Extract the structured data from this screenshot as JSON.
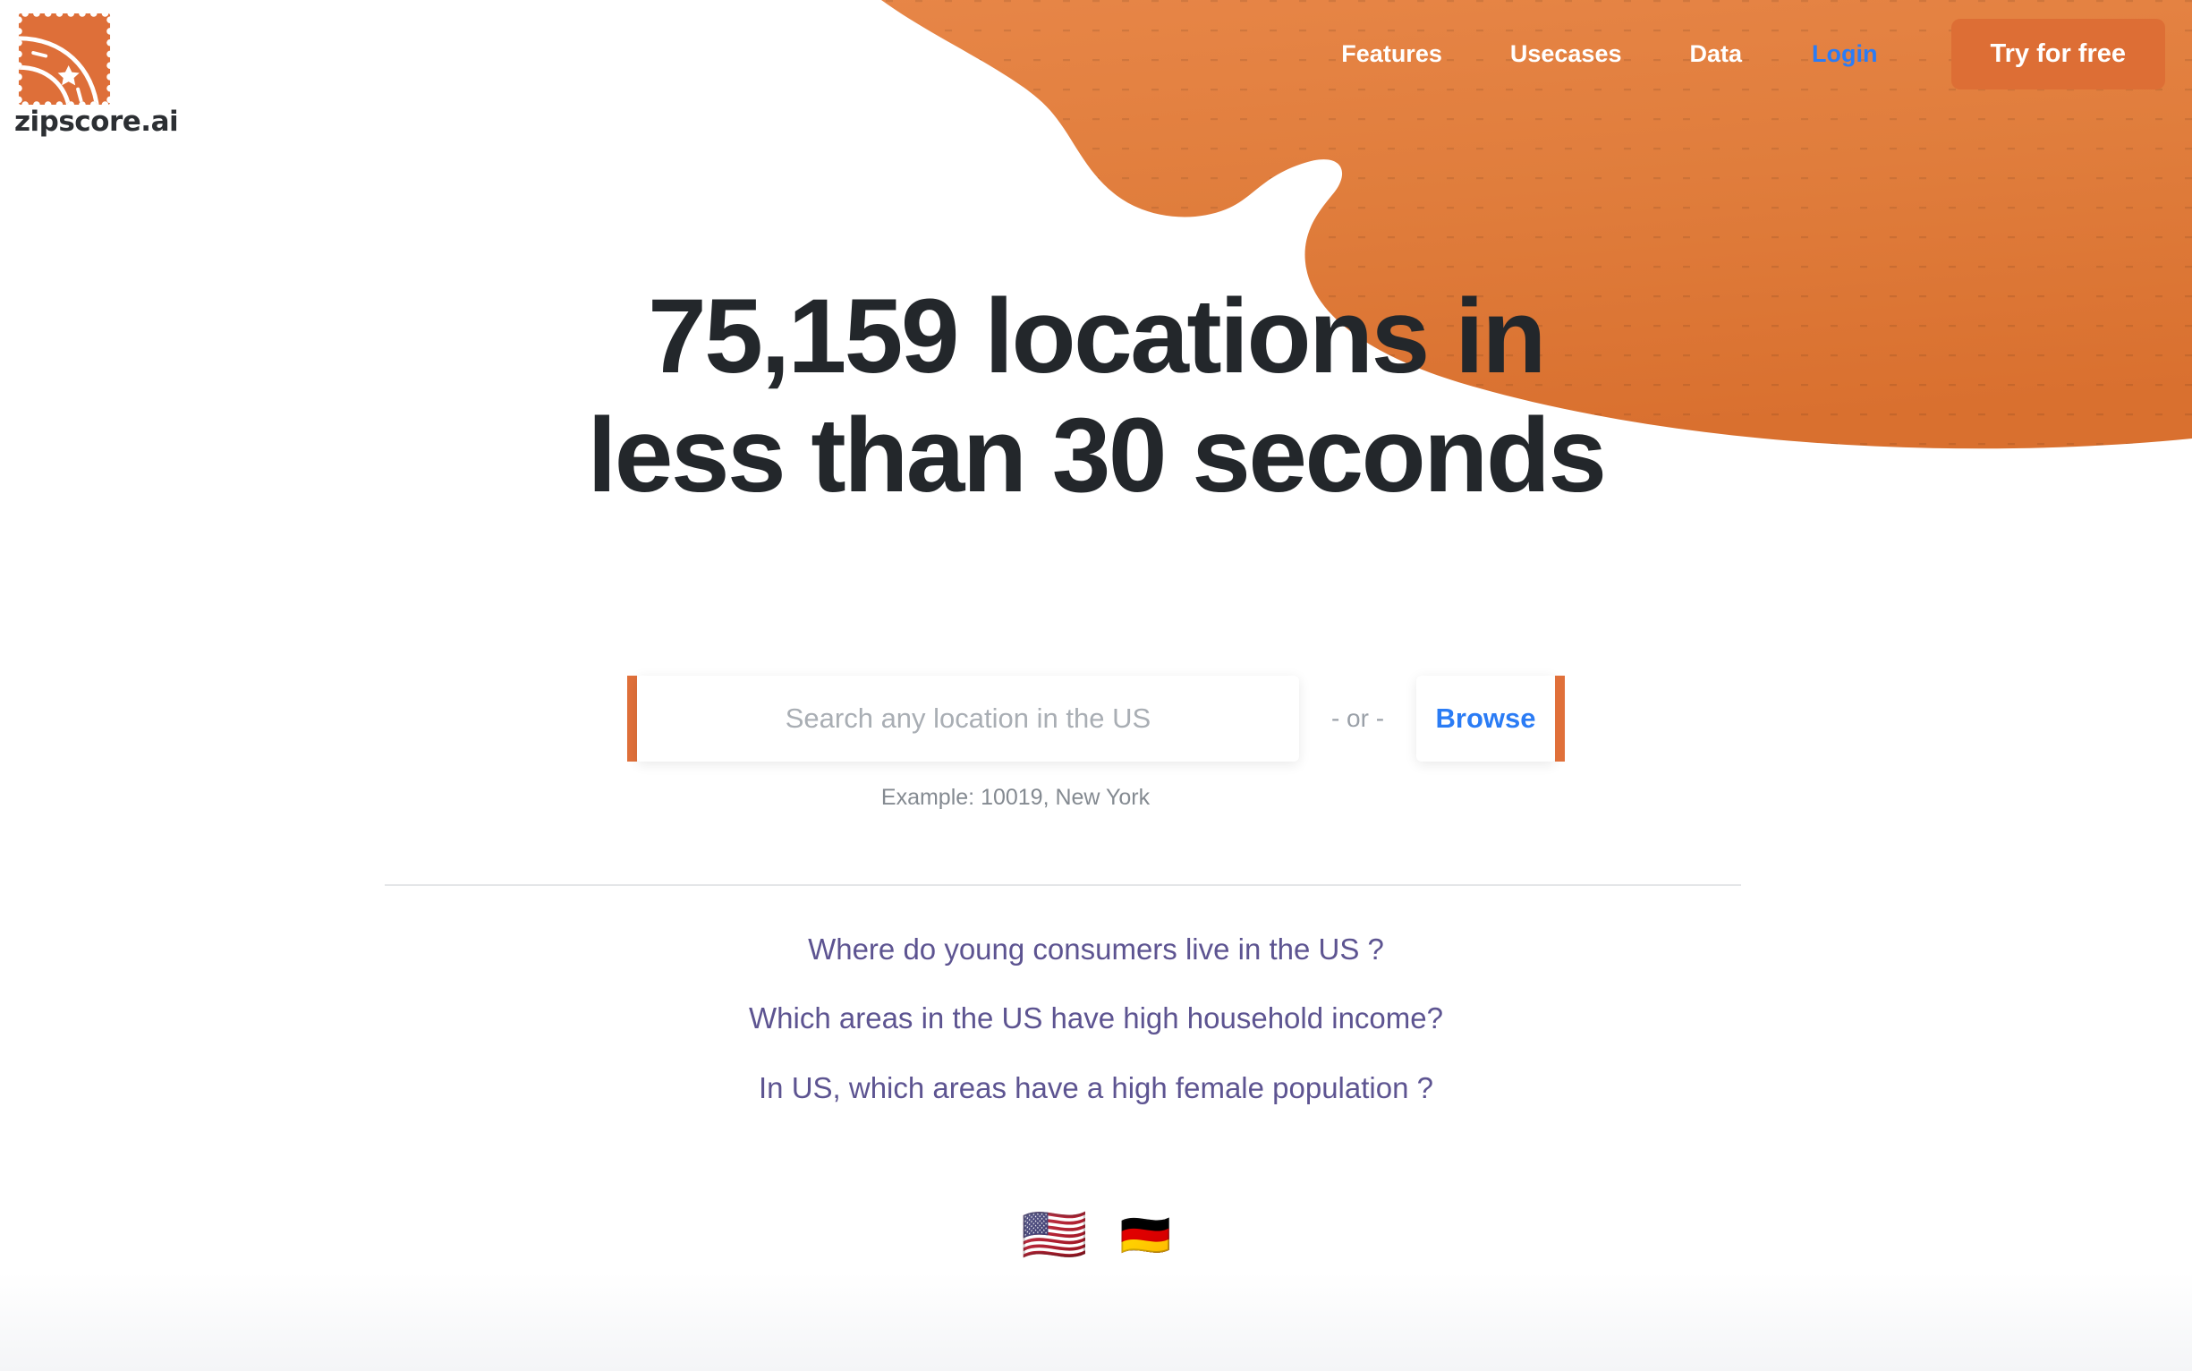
{
  "brand": {
    "logo_icon": "stamp-road-star-icon",
    "name": "zipscore.ai",
    "accent_orange": "#e0703a",
    "blob_orange": "#e07d3c",
    "cta_orange": "#dd6e35",
    "link_blue": "#2b7cf5",
    "question_purple": "#5d5491",
    "headline_dark": "#23272b"
  },
  "nav": {
    "items": [
      {
        "label": "Features",
        "style": "white"
      },
      {
        "label": "Usecases",
        "style": "white"
      },
      {
        "label": "Data",
        "style": "white"
      },
      {
        "label": "Login",
        "style": "blue"
      }
    ],
    "cta_label": "Try for free"
  },
  "hero": {
    "line1": "75,159 locations in",
    "line2": "less than 30 seconds"
  },
  "search": {
    "placeholder": "Search any location in the US",
    "value": "",
    "separator": "- or -",
    "browse_label": "Browse",
    "example": "Example: 10019, New York"
  },
  "questions": [
    {
      "label": "Where do young consumers live in the US ?"
    },
    {
      "label": "Which areas in the US have high household income?"
    },
    {
      "label": "In US, which areas have a high female population ?"
    }
  ],
  "locales": [
    {
      "icon": "flag-us-icon",
      "glyph": "🇺🇸",
      "name": "United States",
      "active": true
    },
    {
      "icon": "flag-de-icon",
      "glyph": "🇩🇪",
      "name": "Germany",
      "active": false
    }
  ]
}
